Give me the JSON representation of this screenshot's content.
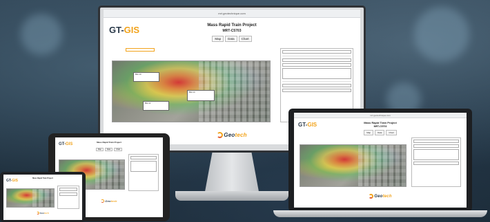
{
  "app": {
    "url": "mrt.geotechnique.com",
    "brand_gt": "GT-",
    "brand_gis": "GIS",
    "title": "Mass Rapid Train Project",
    "subtitle": "MRT-C5703",
    "tabs": [
      "Map",
      "Data",
      "Chart"
    ],
    "map_popups": [
      {
        "id": "BH-10",
        "text": "BH-10"
      },
      {
        "id": "BH-14",
        "text": "BH-14"
      },
      {
        "id": "BH-11",
        "text": "BH-11"
      }
    ],
    "logo_text_a": "Geo",
    "logo_text_b": "tech"
  },
  "colors": {
    "brand_dark": "#2b3a4a",
    "brand_accent": "#f2a31b",
    "legend": [
      "#3a7bd5",
      "#5bc0de",
      "#5cb85c",
      "#f0ad4e",
      "#d9534f",
      "#9b59b6"
    ]
  }
}
